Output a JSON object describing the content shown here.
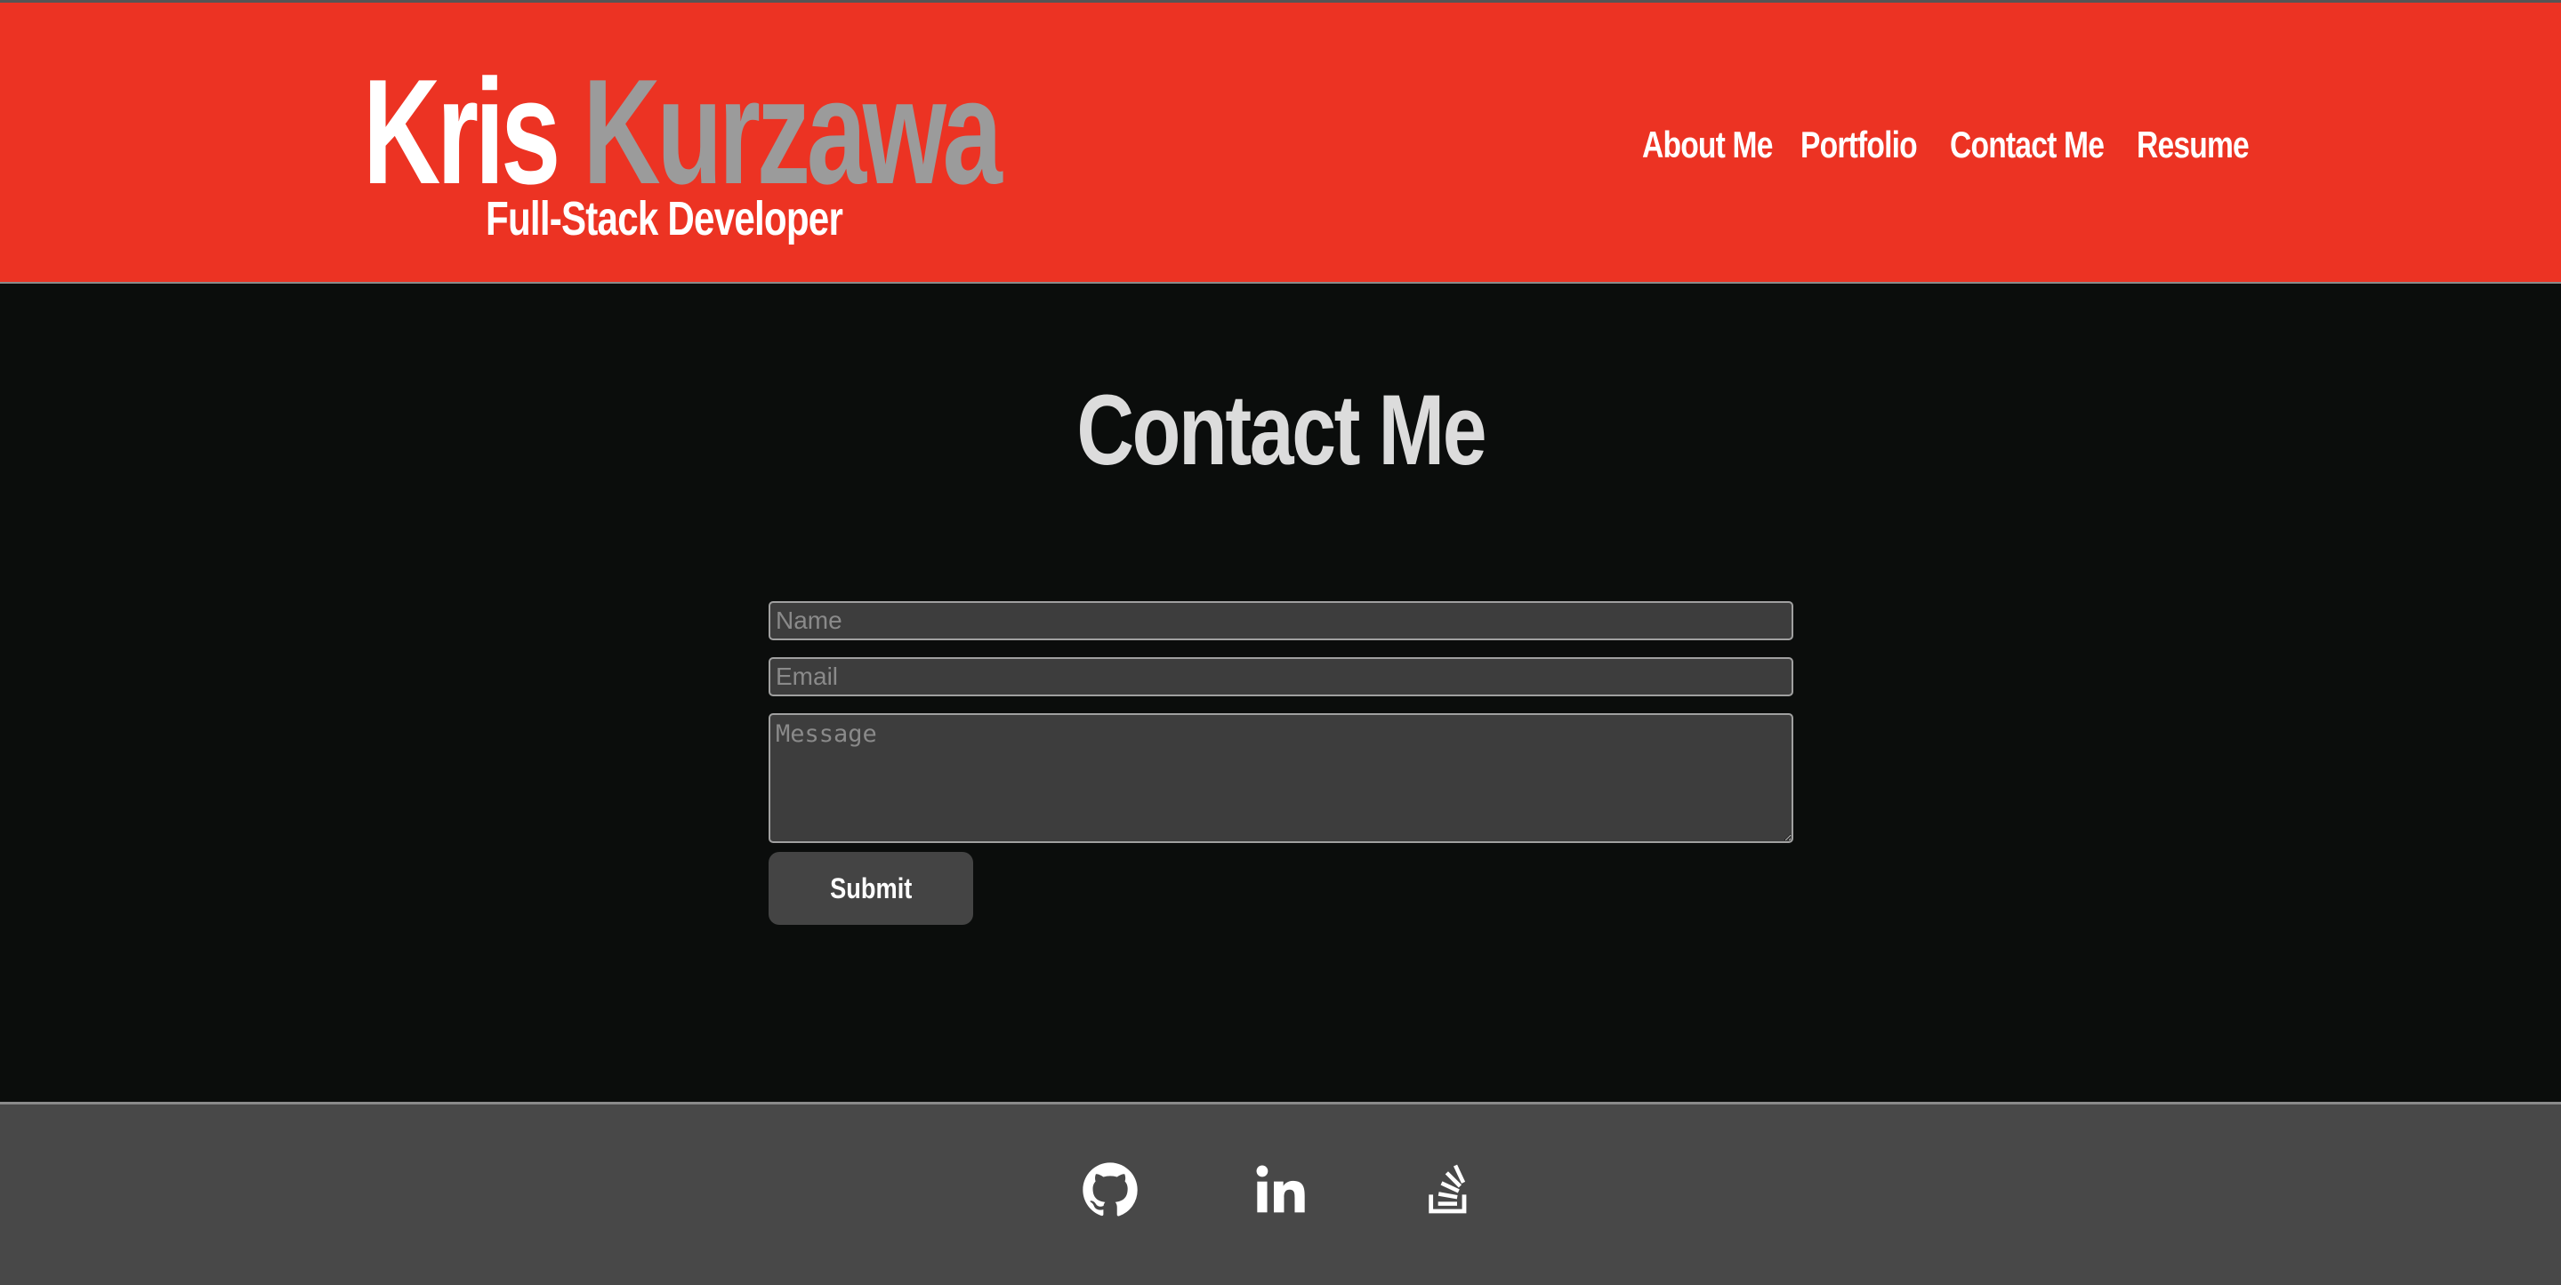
{
  "header": {
    "brand_first": "Kris",
    "brand_last": "Kurzawa",
    "subtitle": "Full-Stack Developer",
    "nav": {
      "about": "About Me",
      "portfolio": "Portfolio",
      "contact": "Contact Me",
      "resume": "Resume"
    }
  },
  "main": {
    "title": "Contact Me",
    "form": {
      "name_placeholder": "Name",
      "email_placeholder": "Email",
      "message_placeholder": "Message",
      "submit_label": "Submit"
    }
  },
  "footer": {
    "icons": [
      "github-icon",
      "linkedin-icon",
      "stackoverflow-icon"
    ]
  },
  "colors": {
    "header_bg": "#ec3323",
    "body_bg": "#0b0d0c",
    "footer_bg": "#484848",
    "brand_last": "#9b9b9b",
    "input_bg": "#3d3d3d",
    "button_bg": "#444444"
  }
}
